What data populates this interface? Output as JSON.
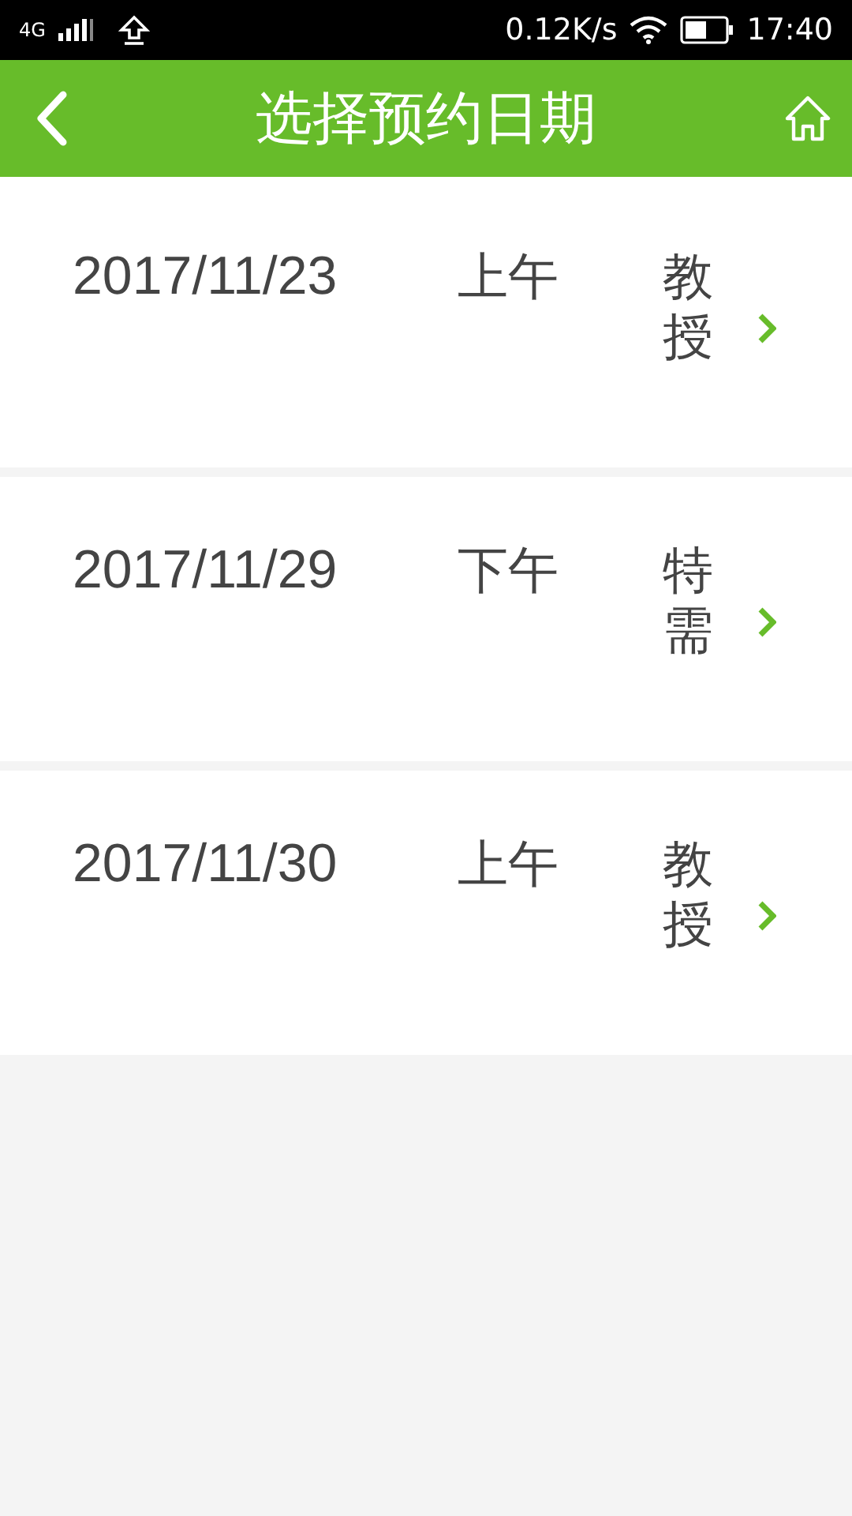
{
  "status_bar": {
    "network": "4G",
    "speed": "0.12K/s",
    "time": "17:40"
  },
  "header": {
    "title": "选择预约日期"
  },
  "slots": [
    {
      "date": "2017/11/23",
      "period": "上午",
      "title": "教授"
    },
    {
      "date": "2017/11/29",
      "period": "下午",
      "title": "特需"
    },
    {
      "date": "2017/11/30",
      "period": "上午",
      "title": "教授"
    }
  ]
}
